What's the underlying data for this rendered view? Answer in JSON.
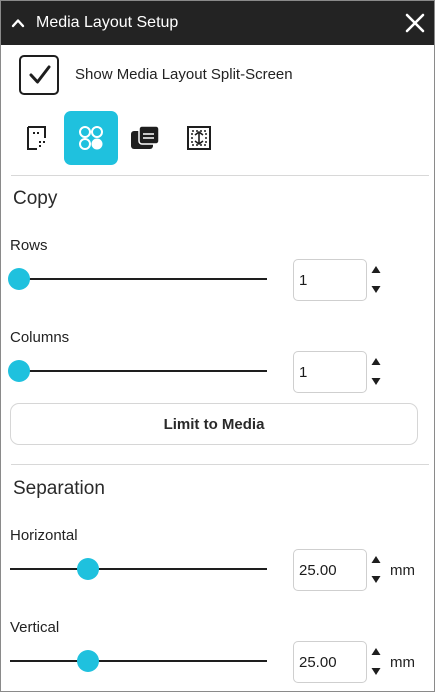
{
  "titlebar": {
    "title": "Media Layout Setup",
    "collapse_icon": "chevron-up-icon",
    "close_icon": "close-icon"
  },
  "split_screen": {
    "label": "Show Media Layout Split-Screen",
    "checked": true
  },
  "mode_buttons": [
    {
      "icon": "page-dotted-corner-icon",
      "active": false
    },
    {
      "icon": "four-circles-layout-icon",
      "active": true
    },
    {
      "icon": "roll-media-icon",
      "active": false
    },
    {
      "icon": "page-fit-icon",
      "active": false
    }
  ],
  "copy": {
    "title": "Copy",
    "rows": {
      "label": "Rows",
      "value": "1",
      "slider_fraction": 0.0
    },
    "columns": {
      "label": "Columns",
      "value": "1",
      "slider_fraction": 0.0
    },
    "limit_button": "Limit to Media"
  },
  "separation": {
    "title": "Separation",
    "horizontal": {
      "label": "Horizontal",
      "value": "25.00",
      "unit": "mm",
      "slider_fraction": 0.27
    },
    "vertical": {
      "label": "Vertical",
      "value": "25.00",
      "unit": "mm",
      "slider_fraction": 0.27
    }
  },
  "colors": {
    "accent": "#1fc1de",
    "titlebar_bg": "#232323"
  }
}
